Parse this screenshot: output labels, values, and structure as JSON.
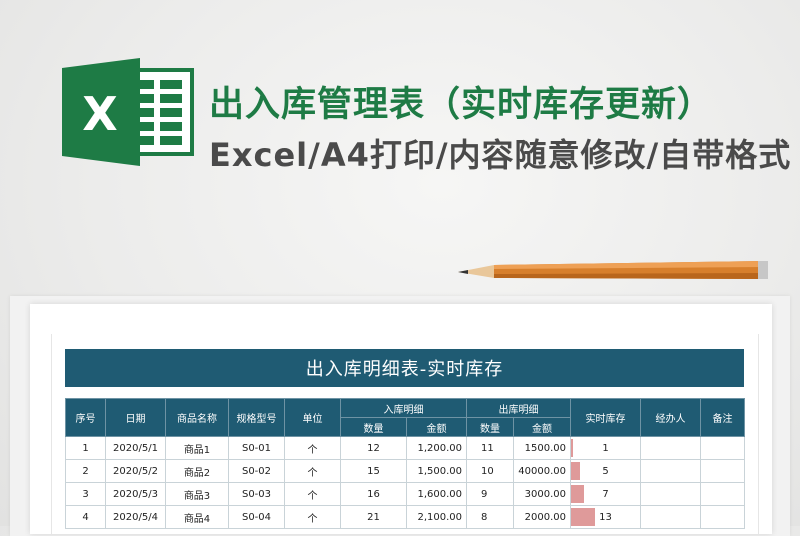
{
  "header": {
    "title": "出入库管理表（实时库存更新）",
    "subtitle": "Excel/A4打印/内容随意修改/自带格式"
  },
  "logo": {
    "letter": "X",
    "icon": "excel-logo-icon",
    "brand_color": "#1e7b45"
  },
  "sheet": {
    "banner_title": "出入库明细表-实时库存",
    "header_color": "#1f5b73",
    "columns": {
      "index": "序号",
      "date": "日期",
      "name": "商品名称",
      "spec": "规格型号",
      "unit": "单位",
      "inbound": "入库明细",
      "outbound": "出库明细",
      "stock": "实时库存",
      "handler": "经办人",
      "remark": "备注",
      "qty": "数量",
      "amount": "金额"
    },
    "rows": [
      {
        "index": "1",
        "date": "2020/5/1",
        "name": "商品1",
        "spec": "S0-01",
        "unit": "个",
        "in_qty": "12",
        "in_amount": "1,200.00",
        "out_qty": "11",
        "out_amount": "1500.00",
        "stock": "1",
        "stock_level": 1,
        "handler": "",
        "remark": ""
      },
      {
        "index": "2",
        "date": "2020/5/2",
        "name": "商品2",
        "spec": "S0-02",
        "unit": "个",
        "in_qty": "15",
        "in_amount": "1,500.00",
        "out_qty": "10",
        "out_amount": "40000.00",
        "stock": "5",
        "stock_level": 5,
        "handler": "",
        "remark": ""
      },
      {
        "index": "3",
        "date": "2020/5/3",
        "name": "商品3",
        "spec": "S0-03",
        "unit": "个",
        "in_qty": "16",
        "in_amount": "1,600.00",
        "out_qty": "9",
        "out_amount": "3000.00",
        "stock": "7",
        "stock_level": 7,
        "handler": "",
        "remark": ""
      },
      {
        "index": "4",
        "date": "2020/5/4",
        "name": "商品4",
        "spec": "S0-04",
        "unit": "个",
        "in_qty": "21",
        "in_amount": "2,100.00",
        "out_qty": "8",
        "out_amount": "2000.00",
        "stock": "13",
        "stock_level": 13,
        "handler": "",
        "remark": ""
      }
    ],
    "stock_bar_color": "#df9a9a"
  }
}
